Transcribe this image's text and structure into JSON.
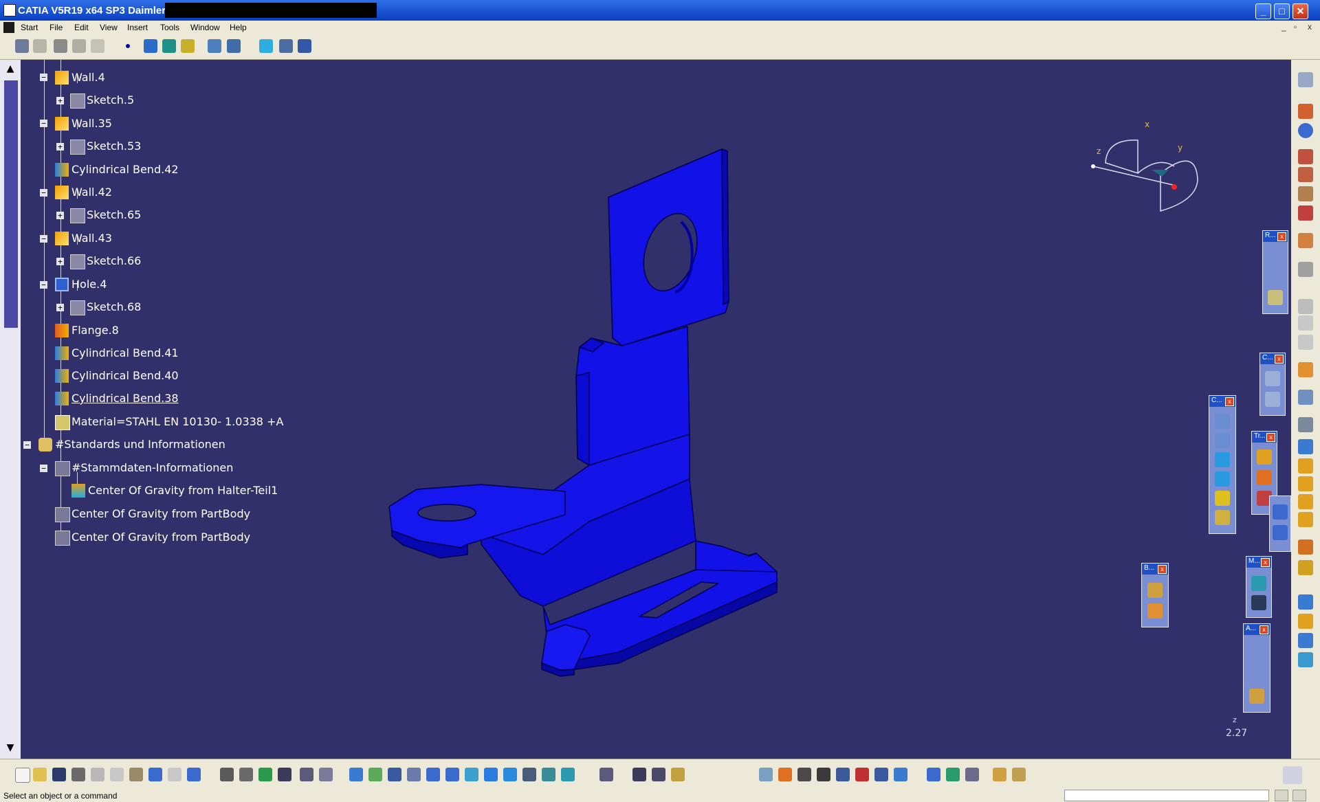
{
  "window": {
    "title": "CATIA V5R19 x64 SP3 Daimler AG",
    "controls": {
      "minimize": "_",
      "maximize": "□",
      "close": "✕"
    }
  },
  "menu": {
    "items": [
      "Start",
      "File",
      "Edit",
      "View",
      "Insert",
      "Tools",
      "Window",
      "Help"
    ],
    "doc_controls": [
      "_",
      "▫",
      "x"
    ]
  },
  "tree": {
    "nodes": [
      {
        "label": "Wall.4",
        "icon": "wall-icon"
      },
      {
        "label": "Sketch.5",
        "icon": "sketch-icon"
      },
      {
        "label": "Wall.35",
        "icon": "wall-icon"
      },
      {
        "label": "Sketch.53",
        "icon": "sketch-icon"
      },
      {
        "label": "Cylindrical Bend.42",
        "icon": "cylindrical-bend-icon"
      },
      {
        "label": "Wall.42",
        "icon": "wall-icon"
      },
      {
        "label": "Sketch.65",
        "icon": "sketch-icon"
      },
      {
        "label": "Wall.43",
        "icon": "wall-icon"
      },
      {
        "label": "Sketch.66",
        "icon": "sketch-icon"
      },
      {
        "label": "Hole.4",
        "icon": "hole-icon"
      },
      {
        "label": "Sketch.68",
        "icon": "sketch-icon"
      },
      {
        "label": "Flange.8",
        "icon": "flange-icon"
      },
      {
        "label": "Cylindrical Bend.41",
        "icon": "cylindrical-bend-icon"
      },
      {
        "label": "Cylindrical Bend.40",
        "icon": "cylindrical-bend-icon"
      },
      {
        "label": "Cylindrical Bend.38",
        "icon": "cylindrical-bend-icon"
      },
      {
        "label": "Material=STAHL EN 10130- 1.0338  +A",
        "icon": "material-icon"
      },
      {
        "label": "#Standards und Informationen",
        "icon": "standards-icon"
      },
      {
        "label": "#Stammdaten-Informationen",
        "icon": "master-data-icon"
      },
      {
        "label": "Center Of Gravity from Halter-Teil1",
        "icon": "center-of-gravity-icon"
      },
      {
        "label": "Center Of Gravity from PartBody",
        "icon": "center-of-gravity-icon"
      },
      {
        "label": "Center Of Gravity from PartBody",
        "icon": "center-of-gravity-icon"
      }
    ]
  },
  "compass": {
    "x_label": "x",
    "y_label": "y",
    "z_label": "z"
  },
  "panels": {
    "reference": "R...",
    "constraints": "C...",
    "cutting": "C...",
    "transform": "Tr...",
    "bending": "B...",
    "measure": "M...",
    "annotations": "A..."
  },
  "view": {
    "scale": "2.27",
    "axis_small": "z"
  },
  "status": {
    "prompt": "Select an object or a command"
  },
  "colors": {
    "viewport_bg": "#32306a",
    "part_fill": "#1212e8",
    "part_edge": "#000050",
    "tree_text": "#ffffff",
    "titlebar": "#0a3fc0"
  }
}
